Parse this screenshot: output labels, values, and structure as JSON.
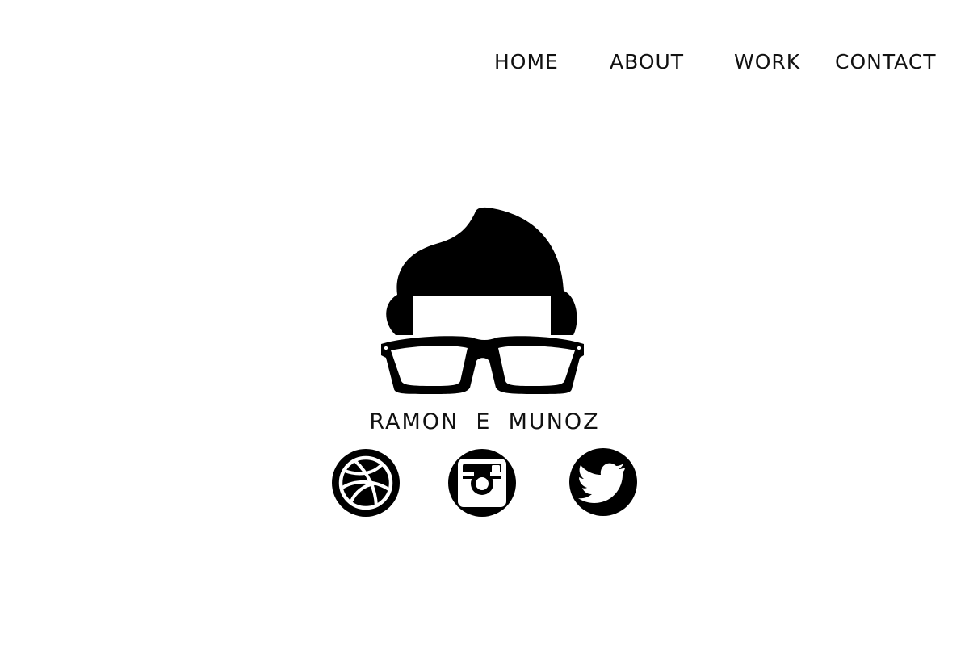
{
  "nav": {
    "items": [
      {
        "label": "HOME"
      },
      {
        "label": "ABOUT"
      },
      {
        "label": "WORK"
      },
      {
        "label": "CONTACT"
      }
    ]
  },
  "hero": {
    "logo_icon": "nerd-face-with-glasses-icon",
    "name": "RAMON  E  MUNOZ"
  },
  "social": [
    {
      "icon": "dribbble-icon"
    },
    {
      "icon": "instagram-icon"
    },
    {
      "icon": "twitter-icon"
    }
  ],
  "colors": {
    "background": "#ffffff",
    "foreground": "#000000"
  }
}
